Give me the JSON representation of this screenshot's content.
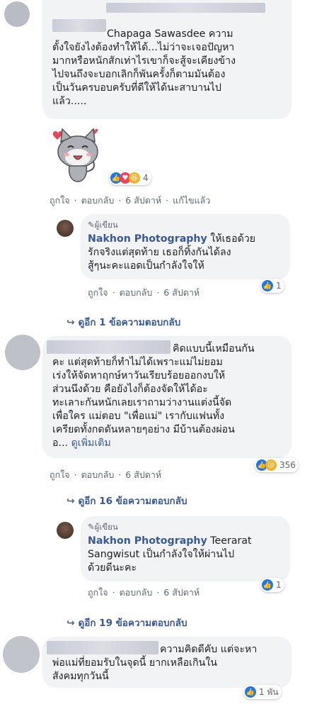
{
  "comments": [
    {
      "id": "c1",
      "text_lines": [
        "Chapaga Sawasdee ความ",
        "ตั้งใจยังไงต้องทำให้ได้...ไม่ว่าจะเจอปัญหา",
        "มากหรือหนักสักเท่าไรเขาก็จะสู้จะเคียงข้าง",
        "ไปจนถึงจะบอกเลิกก็พันครั้งก็ตามมันต้อง",
        "เป็นวันครบอบครับที่ดีให้ได้นะสาบานไป",
        "แล้ว....."
      ],
      "reaction_count": "4",
      "actions": {
        "like": "ถูกใจ",
        "reply": "ตอบกลับ",
        "time": "6 สัปดาห์",
        "edited": "แก้ไขแล้ว"
      }
    },
    {
      "id": "r1",
      "author_badge": "ผู้เขียน",
      "name": "Nakhon Photography",
      "text_first": " ให้เธอด้วย",
      "text_lines": [
        "รักจริงแต่สุดท้าย เธอก็ทิ้งกันได้ลง",
        "สู้ๆนะคะแอดเป็นกำลังใจให้"
      ],
      "reaction_count": "1",
      "actions": {
        "like": "ถูกใจ",
        "reply": "ตอบกลับ",
        "time": "6 สัปดาห์"
      }
    },
    {
      "id": "more1",
      "label": "ดูอีก 1 ข้อความตอบกลับ"
    },
    {
      "id": "c2",
      "text_first": "คิดแบบนี้เหมือนกัน",
      "text_lines": [
        "คะ แต่สุดท้ายก็ทำไม่ได้เพราะแม่ไม่ยอม",
        "เร่งให้จัดหาฤกษ์หาวันเรียบร้อยออกงบให้",
        "ส่วนนึงด้วย คือยังไงก็ต้องจัดให้ได้อะ",
        "ทะเลาะกันหนักเลยเราถามว่างานแต่งนี้จัด",
        "เพื่อใคร แม่ตอบ \"เพื่อแม่\" เรากับแฟนทั้ง",
        "เครียดทั้งกดดันหลายๆอย่าง มีบ้านต้องผ่อน"
      ],
      "last_line_prefix": "อ... ",
      "see_more": "ดูเพิ่มเติม",
      "reaction_count": "356",
      "actions": {
        "like": "ถูกใจ",
        "reply": "ตอบกลับ",
        "time": "6 สัปดาห์"
      }
    },
    {
      "id": "more2",
      "label": "ดูอีก 16 ข้อความตอบกลับ"
    },
    {
      "id": "r2",
      "author_badge": "ผู้เขียน",
      "name": "Nakhon Photography",
      "text_first": " Teerarat",
      "text_lines": [
        "Sangwisut เป็นกำลังใจให้ผ่านไป",
        "ด้วยดีนะคะ"
      ],
      "reaction_count": "1",
      "actions": {
        "like": "ถูกใจ",
        "reply": "ตอบกลับ",
        "time": "6 สัปดาห์"
      }
    },
    {
      "id": "more3",
      "label": "ดูอีก 19 ข้อความตอบกลับ"
    },
    {
      "id": "c3",
      "text_first": "ความคิดดีคับ แต่จะหา",
      "text_lines": [
        "พ่อแม่ที่ยอมรับในจุดนี้ ยากเหลือเกินใน",
        "สังคมทุกวันนี้"
      ],
      "reaction_count": "1 พัน"
    }
  ]
}
